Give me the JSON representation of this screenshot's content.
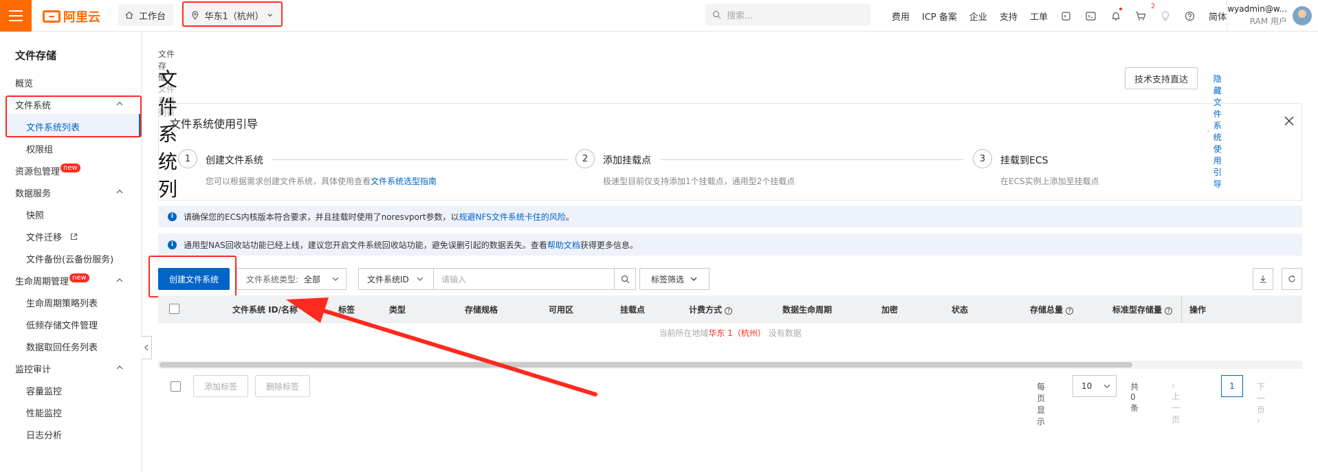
{
  "topbar": {
    "logo_text": "阿里云",
    "workbench_label": "工作台",
    "region_label": "华东1（杭州）",
    "search_placeholder": "搜索...",
    "nav": [
      "费用",
      "ICP 备案",
      "企业",
      "支持",
      "工单"
    ],
    "cart_badge": "2",
    "lang": "简体",
    "user_name": "wyadmin@w...",
    "user_role": "RAM 用户"
  },
  "sidebar": {
    "title": "文件存储",
    "overview": "概览",
    "fs_group": "文件系统",
    "fs_list": "文件系统列表",
    "perm_group": "权限组",
    "resource_pkg": "资源包管理",
    "new_badge": "new",
    "data_service": "数据服务",
    "snapshot": "快照",
    "migration": "文件迁移",
    "backup": "文件备份(云备份服务)",
    "lifecycle": "生命周期管理",
    "lifecycle_policy": "生命周期策略列表",
    "low_freq": "低频存储文件管理",
    "retrieve": "数据取回任务列表",
    "monitor": "监控审计",
    "capacity": "容量监控",
    "perf": "性能监控",
    "log": "日志分析"
  },
  "main": {
    "breadcrumb_root": "文件存储",
    "breadcrumb_current": "文件系统列表",
    "title": "文件系统列表",
    "support_btn": "技术支持直达",
    "hide_guide": "隐藏文件系统使用引导",
    "guide": {
      "title": "文件系统使用引导",
      "steps": [
        {
          "num": "1",
          "title": "创建文件系统",
          "desc": "您可以根据需求创建文件系统，具体使用查看",
          "link": "文件系统选型指南"
        },
        {
          "num": "2",
          "title": "添加挂载点",
          "desc": "极速型目前仅支持添加1个挂载点，通用型2个挂载点",
          "link": ""
        },
        {
          "num": "3",
          "title": "挂载到ECS",
          "desc": "在ECS实例上添加至挂载点",
          "link": ""
        }
      ]
    },
    "notice1_text": "请确保您的ECS内核版本符合要求，并且挂载时使用了noresvport参数，以",
    "notice1_link": "规避NFS文件系统卡住的风险",
    "notice1_end": "。",
    "notice2_text": "通用型NAS回收站功能已经上线，建议您开启文件系统回收站功能，避免误删引起的数据丢失。查看",
    "notice2_link": "帮助文档",
    "notice2_end": "获得更多信息。",
    "create_btn": "创建文件系统",
    "type_label": "文件系统类型:",
    "type_value": "全部",
    "id_select": "文件系统ID",
    "search_placeholder": "请输入",
    "tag_filter": "标签筛选",
    "columns": [
      "文件系统 ID/名称",
      "标签",
      "类型",
      "存储规格",
      "可用区",
      "挂载点",
      "计费方式",
      "数据生命周期",
      "加密",
      "状态",
      "存储总量",
      "标准型存储量",
      "操作"
    ],
    "empty_pre": "当前所在地域",
    "empty_region": "华东 1（杭州）",
    "empty_post": "没有数据",
    "add_tag": "添加标签",
    "del_tag": "删除标签",
    "per_page_label": "每页显示",
    "per_page": "10",
    "total": "共0条",
    "prev": "上一页",
    "page": "1",
    "next": "下一页"
  },
  "colors": {
    "accent": "#ff6a00",
    "primary": "#0064c8",
    "highlight": "#ff2a1f"
  }
}
